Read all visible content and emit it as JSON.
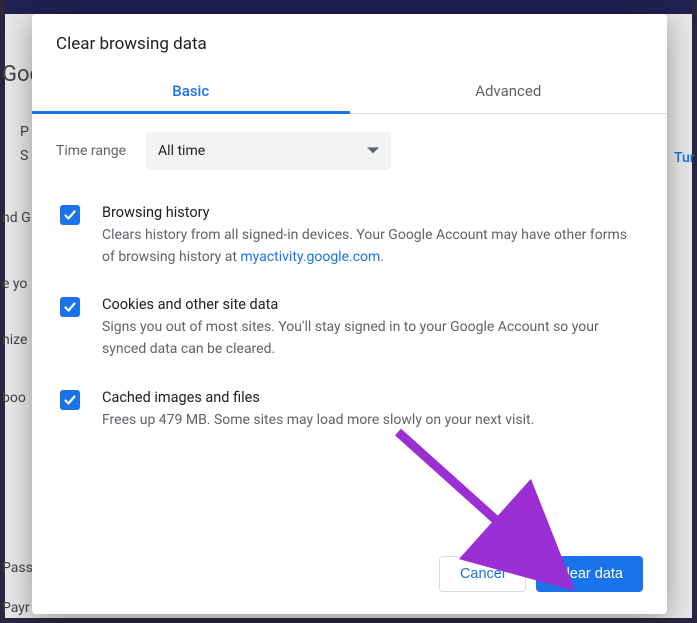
{
  "dialog": {
    "title": "Clear browsing data",
    "tabs": {
      "basic": "Basic",
      "advanced": "Advanced"
    },
    "time_range_label": "Time range",
    "time_range_value": "All time",
    "options": {
      "browsing": {
        "title": "Browsing history",
        "desc_pre": "Clears history from all signed-in devices. Your Google Account may have other forms of browsing history at ",
        "desc_link": "myactivity.google.com",
        "desc_post": "."
      },
      "cookies": {
        "title": "Cookies and other site data",
        "desc": "Signs you out of most sites. You'll stay signed in to your Google Account so your synced data can be cleared."
      },
      "cache": {
        "title": "Cached images and files",
        "desc": "Frees up 479 MB. Some sites may load more slowly on your next visit."
      }
    },
    "buttons": {
      "cancel": "Cancel",
      "clear": "Clear data"
    }
  },
  "background": {
    "goo": "Goo",
    "p": "P",
    "s": "S",
    "nd_g": "nd G",
    "e_yo": "e yo",
    "nize": "nize",
    "boo": "boo",
    "pass": "Pass",
    "payr": "Payr",
    "tur": "Tur"
  }
}
